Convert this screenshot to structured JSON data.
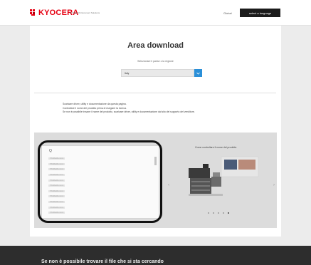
{
  "header": {
    "logo_text": "KYOCERA",
    "tagline": "KYOCERA Document Solutions",
    "global_link": "Global",
    "language_button": "select a language"
  },
  "main": {
    "title": "Area download",
    "subtitle": "Selezionare il paese o la regione",
    "country_select": {
      "value": "Italy",
      "arrow_icon": "chevron-down-icon"
    },
    "info_lines": [
      "Scaricare driver, utility e documentazione da questa pagina.",
      "Controllare il nome del prodotto prima di eseguire la ricerca.",
      "Se non è possibile trovare il nome del prodotto, scaricare driver, utility e documentazione dal sito del supporto del venditore."
    ]
  },
  "product_panel": {
    "search_glyph": "Q",
    "products": [
      "TASKalfa xxxx",
      "TASKalfa xxxx",
      "TASKalfa xxxx",
      "TASKalfa xxxx",
      "TASKalfa xxxx",
      "TASKalfa xxxx",
      "TASKalfa xxxx",
      "TASKalfa xxxx",
      "TASKalfa xxxx",
      "TASKalfa xxxx",
      "TASKalfa xxxx"
    ],
    "howto_title": "Come controllare il nome del prodotto",
    "carousel_prev": "‹",
    "carousel_next": "›",
    "carousel_pages": 5,
    "carousel_active_index": 4
  },
  "footer": {
    "text": "Se non è possibile trovare il file che si sta cercando"
  },
  "colors": {
    "brand_red": "#e60012",
    "accent_blue": "#2a8fd8",
    "footer_bg": "#2d2d2d"
  }
}
